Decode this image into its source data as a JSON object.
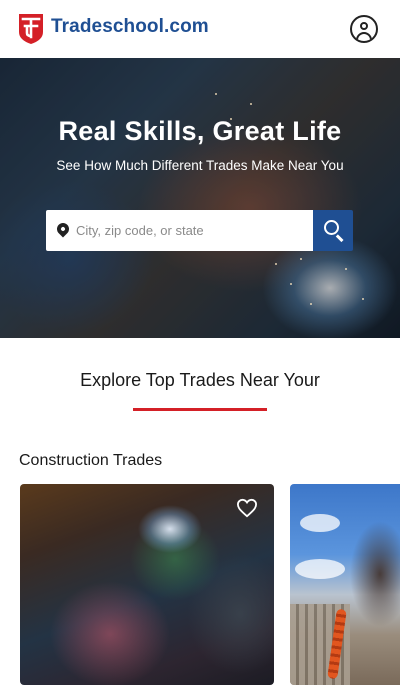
{
  "header": {
    "brand": "Tradeschool.com",
    "logo_icon": "ts-shield-logo-icon",
    "account_icon": "user-account-icon",
    "brand_color": "#1f4f93",
    "logo_color": "#d42027"
  },
  "hero": {
    "title": "Real Skills, Great Life",
    "subtitle": "See How Much Different Trades Make Near You",
    "search": {
      "placeholder": "City, zip code, or state",
      "value": "",
      "pin_icon": "map-pin-icon",
      "button_icon": "search-icon"
    }
  },
  "explore": {
    "title": "Explore Top Trades Near Your",
    "accent_color": "#d42027"
  },
  "sections": [
    {
      "title": "Construction Trades",
      "cards": [
        {
          "image": "welder-photo",
          "favorite_icon": "heart-outline-icon"
        },
        {
          "image": "roofer-photo"
        }
      ]
    }
  ]
}
